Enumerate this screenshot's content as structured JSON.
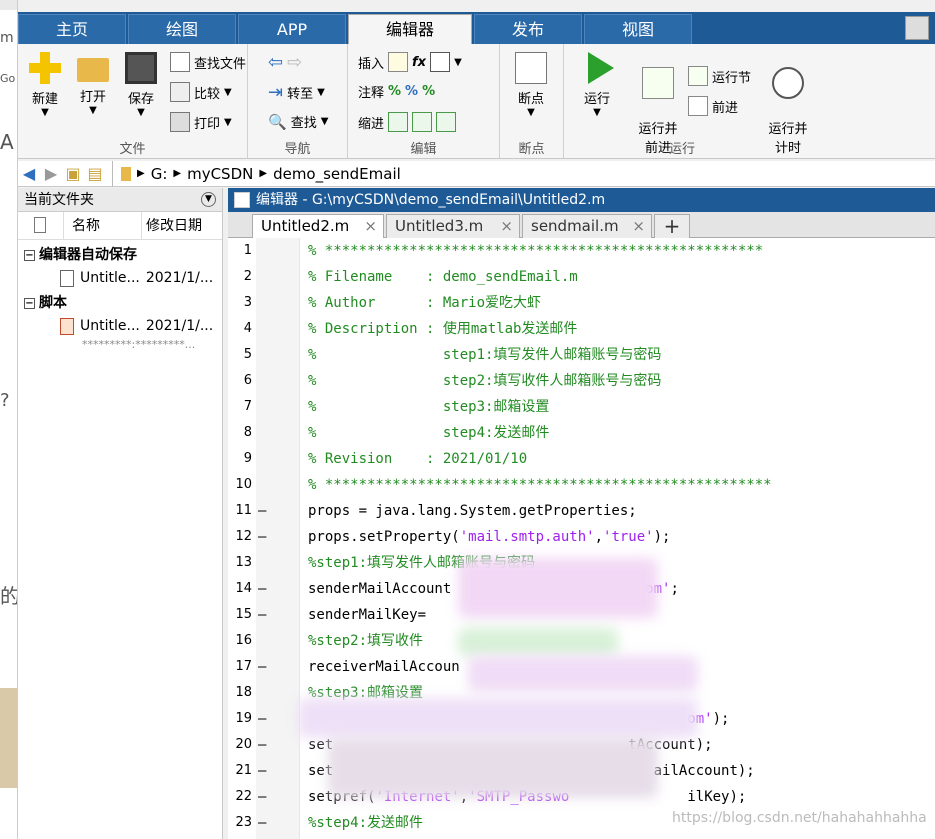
{
  "ribbon_tabs": [
    "主页",
    "绘图",
    "APP",
    "编辑器",
    "发布",
    "视图"
  ],
  "active_tab": "编辑器",
  "groups": {
    "file": {
      "label": "文件",
      "new": "新建",
      "open": "打开",
      "save": "保存",
      "find_files": "查找文件",
      "compare": "比较",
      "print": "打印"
    },
    "nav": {
      "label": "导航",
      "goto": "转至",
      "find": "查找"
    },
    "edit": {
      "label": "编辑",
      "insert": "插入",
      "comment": "注释",
      "indent": "缩进"
    },
    "breakpoint": {
      "label": "断点",
      "breakpoints": "断点"
    },
    "run": {
      "label": "运行",
      "run": "运行",
      "run_advance": "运行并\n前进",
      "run_section": "运行节",
      "advance": "前进",
      "run_time": "运行并\n计时"
    }
  },
  "address": {
    "crumbs": [
      "G:",
      "myCSDN",
      "demo_sendEmail"
    ]
  },
  "left_panel": {
    "title": "当前文件夹",
    "col_name": "名称",
    "col_date": "修改日期",
    "sections": [
      {
        "label": "编辑器自动保存",
        "items": [
          {
            "name": "Untitle...",
            "date": "2021/1/..."
          }
        ]
      },
      {
        "label": "脚本",
        "items": [
          {
            "name": "Untitle...",
            "date": "2021/1/..."
          }
        ],
        "sub": "*********:*********..."
      }
    ]
  },
  "editor": {
    "title": "编辑器 - G:\\myCSDN\\demo_sendEmail\\Untitled2.m",
    "tabs": [
      "Untitled2.m",
      "Untitled3.m",
      "sendmail.m"
    ],
    "plus": "+",
    "close_glyph": "×",
    "lines": [
      {
        "n": "1",
        "dash": false,
        "parts": [
          [
            "cm",
            "% ****************************************************"
          ]
        ]
      },
      {
        "n": "2",
        "dash": false,
        "parts": [
          [
            "cm",
            "% Filename    : demo_sendEmail.m"
          ]
        ]
      },
      {
        "n": "3",
        "dash": false,
        "parts": [
          [
            "cm",
            "% Author      : Mario爱吃大虾"
          ]
        ]
      },
      {
        "n": "4",
        "dash": false,
        "parts": [
          [
            "cm",
            "% Description : 使用matlab发送邮件"
          ]
        ]
      },
      {
        "n": "5",
        "dash": false,
        "parts": [
          [
            "cm",
            "%               step1:填写发件人邮箱账号与密码"
          ]
        ]
      },
      {
        "n": "6",
        "dash": false,
        "parts": [
          [
            "cm",
            "%               step2:填写收件人邮箱账号与密码"
          ]
        ]
      },
      {
        "n": "7",
        "dash": false,
        "parts": [
          [
            "cm",
            "%               step3:邮箱设置"
          ]
        ]
      },
      {
        "n": "8",
        "dash": false,
        "parts": [
          [
            "cm",
            "%               step4:发送邮件"
          ]
        ]
      },
      {
        "n": "9",
        "dash": false,
        "parts": [
          [
            "cm",
            "% Revision    : 2021/01/10"
          ]
        ]
      },
      {
        "n": "10",
        "dash": false,
        "parts": [
          [
            "cm",
            "% *****************************************************"
          ]
        ]
      },
      {
        "n": "11",
        "dash": true,
        "parts": [
          [
            "",
            "props = java.lang.System.getProperties;"
          ]
        ]
      },
      {
        "n": "12",
        "dash": true,
        "parts": [
          [
            "",
            "props.setProperty("
          ],
          [
            "str",
            "'mail.smtp.auth'"
          ],
          [
            "",
            ","
          ],
          [
            "str",
            "'true'"
          ],
          [
            "",
            ");"
          ]
        ]
      },
      {
        "n": "13",
        "dash": false,
        "parts": [
          [
            "cm",
            "%step1:填写发件人邮箱账号与密码"
          ]
        ]
      },
      {
        "n": "14",
        "dash": true,
        "parts": [
          [
            "",
            "senderMailAccount"
          ],
          [
            "str",
            "                     .com'"
          ],
          [
            "",
            ";"
          ]
        ]
      },
      {
        "n": "15",
        "dash": true,
        "parts": [
          [
            "",
            "senderMailKey="
          ]
        ]
      },
      {
        "n": "16",
        "dash": false,
        "parts": [
          [
            "cm",
            "%step2:填写收件"
          ]
        ]
      },
      {
        "n": "17",
        "dash": true,
        "parts": [
          [
            "",
            "receiverMailAccoun"
          ]
        ]
      },
      {
        "n": "18",
        "dash": false,
        "parts": [
          [
            "cm",
            "%step3:邮箱设置"
          ]
        ]
      },
      {
        "n": "19",
        "dash": true,
        "parts": [
          [
            "str",
            "                                            com'"
          ],
          [
            "",
            ");"
          ]
        ]
      },
      {
        "n": "20",
        "dash": true,
        "parts": [
          [
            "",
            "set                                   tAccount);"
          ]
        ]
      },
      {
        "n": "21",
        "dash": true,
        "parts": [
          [
            "",
            "set"
          ],
          [
            "str",
            "              , 'SMTP_"
          ],
          [
            "",
            "                ailAccount);"
          ]
        ]
      },
      {
        "n": "22",
        "dash": true,
        "parts": [
          [
            "",
            "setpref("
          ],
          [
            "str",
            "'Internet'"
          ],
          [
            "",
            ","
          ],
          [
            "str",
            "'SMTP_Passwo"
          ],
          [
            "",
            "              ilKey);"
          ]
        ]
      },
      {
        "n": "23",
        "dash": true,
        "parts": [
          [
            "cm",
            "%step4:发送邮件"
          ]
        ]
      }
    ]
  },
  "watermark": "https://blog.csdn.net/hahahahhahha",
  "bleed_texts": [
    "m",
    "Go",
    "A",
    "?",
    "的"
  ],
  "colors": {
    "accent": "#1d5a96",
    "comment": "#228b22",
    "string": "#a020f0"
  }
}
